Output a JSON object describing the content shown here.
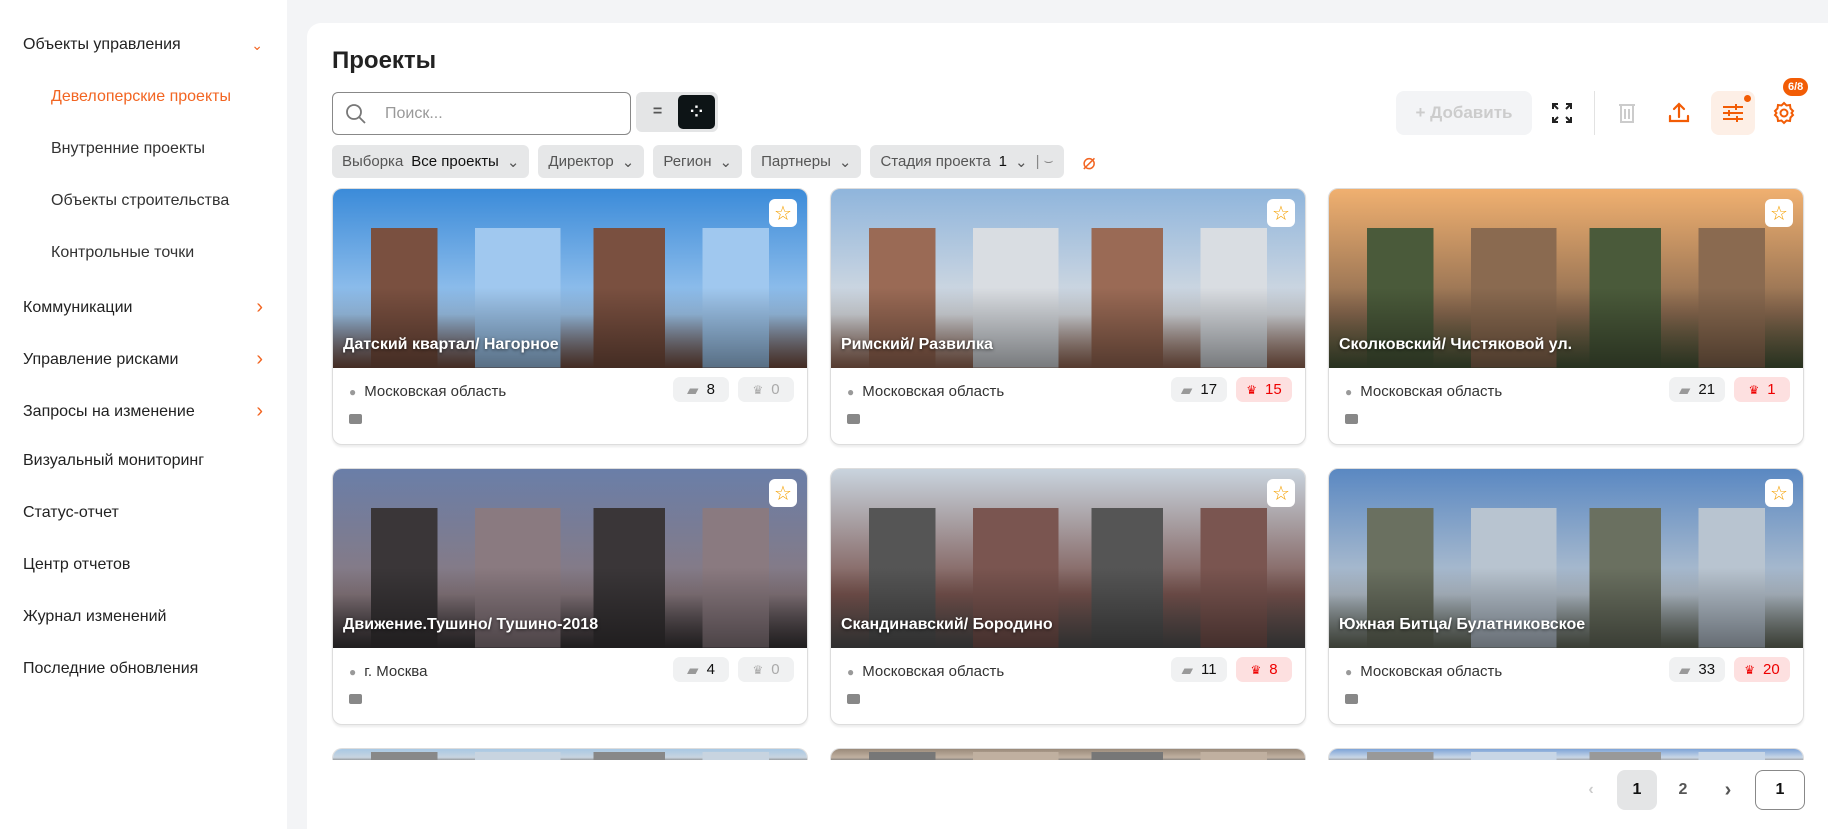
{
  "sidebar": {
    "items": [
      {
        "label": "Объекты управления",
        "chevron": "down",
        "level": 0
      },
      {
        "label": "Девелоперские проекты",
        "level": 1,
        "active": true
      },
      {
        "label": "Внутренние проекты",
        "level": 1
      },
      {
        "label": "Объекты строительства",
        "level": 1
      },
      {
        "label": "Контрольные точки",
        "level": 1
      },
      {
        "label": "Коммуникации",
        "chevron": "right",
        "level": 0
      },
      {
        "label": "Управление рисками",
        "chevron": "right",
        "level": 0
      },
      {
        "label": "Запросы на изменение",
        "chevron": "right",
        "level": 0
      },
      {
        "label": "Визуальный мониторинг",
        "level": 0
      },
      {
        "label": "Статус-отчет",
        "level": 0
      },
      {
        "label": "Центр отчетов",
        "level": 0
      },
      {
        "label": "Журнал изменений",
        "level": 0
      },
      {
        "label": "Последние обновления",
        "level": 0
      }
    ]
  },
  "main": {
    "title": "Проекты",
    "search_placeholder": "Поиск...",
    "add_label": "+ Добавить",
    "settings_badge": "6/8",
    "filters": [
      {
        "label": "Выборка",
        "value": "Все проекты"
      },
      {
        "label": "Директор",
        "value": ""
      },
      {
        "label": "Регион",
        "value": ""
      },
      {
        "label": "Партнеры",
        "value": ""
      },
      {
        "label": "Стадия проекта",
        "value": "1"
      }
    ]
  },
  "accent": "#f26522",
  "projects": [
    {
      "name": "Датский квартал/ Нагорное",
      "region": "Московская область",
      "buildings": "8",
      "issues": "0",
      "colors": [
        "#3b8bd9",
        "#a0c8ef",
        "#7a5040"
      ]
    },
    {
      "name": "Римский/ Развилка",
      "region": "Московская область",
      "buildings": "17",
      "issues": "15",
      "colors": [
        "#8fb5dc",
        "#d9dde2",
        "#9a6a55"
      ]
    },
    {
      "name": "Сколковский/ Чистяковой ул.",
      "region": "Московская область",
      "buildings": "21",
      "issues": "1",
      "colors": [
        "#f0b070",
        "#8a6a50",
        "#4a5a3a"
      ]
    },
    {
      "name": "Движение.Тушино/ Тушино-2018",
      "region": "г. Москва",
      "buildings": "4",
      "issues": "0",
      "colors": [
        "#6a7ea8",
        "#8a7a80",
        "#3a3638"
      ]
    },
    {
      "name": "Скандинавский/ Бородино",
      "region": "Московская область",
      "buildings": "11",
      "issues": "8",
      "colors": [
        "#c9d4de",
        "#7a5550",
        "#555"
      ]
    },
    {
      "name": "Южная Битца/ Булатниковское",
      "region": "Московская область",
      "buildings": "33",
      "issues": "20",
      "colors": [
        "#5a88c2",
        "#b8c4d0",
        "#6a7060"
      ]
    },
    {
      "name": "",
      "region": "",
      "buildings": "",
      "issues": "",
      "colors": [
        "#a8c8e4",
        "#c8d4e0",
        "#888"
      ]
    },
    {
      "name": "",
      "region": "",
      "buildings": "",
      "issues": "",
      "colors": [
        "#9a8a7a",
        "#c0b0a0",
        "#777"
      ]
    },
    {
      "name": "",
      "region": "",
      "buildings": "",
      "issues": "",
      "colors": [
        "#7ea4d8",
        "#c8d6e6",
        "#999"
      ]
    }
  ],
  "pagination": {
    "pages": [
      "1",
      "2"
    ],
    "current": "1",
    "goto_value": "1"
  }
}
